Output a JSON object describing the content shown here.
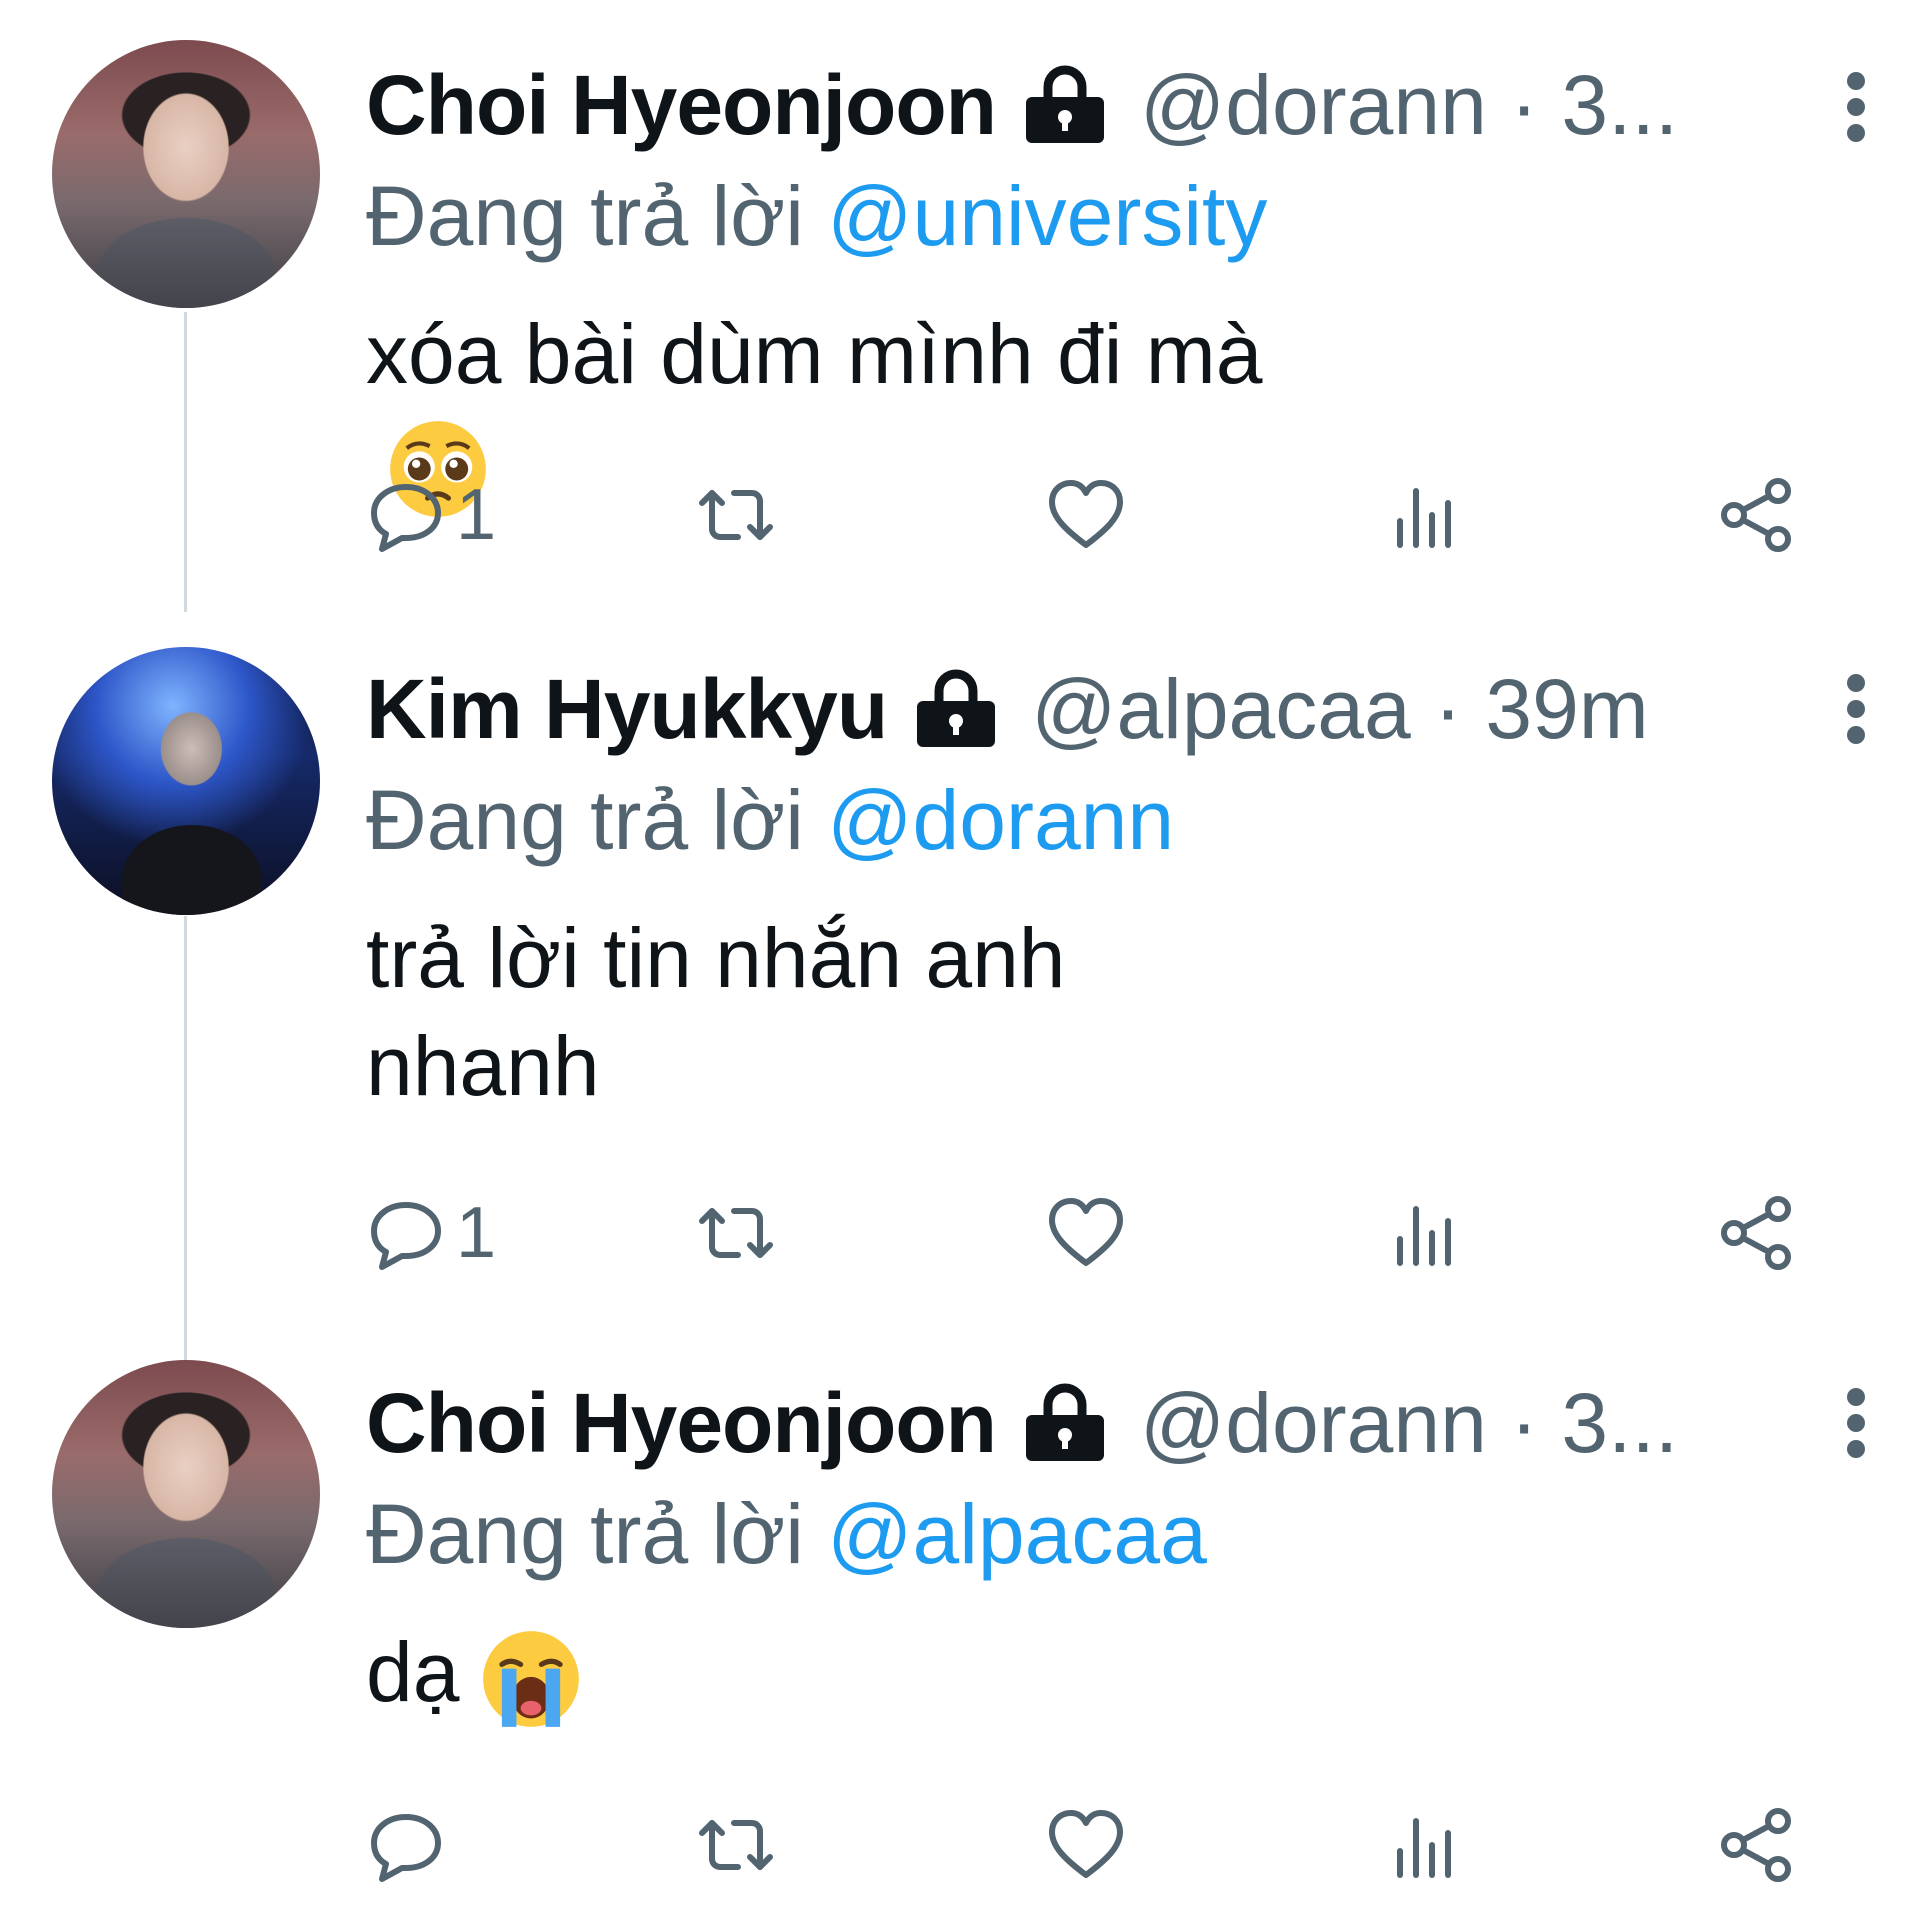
{
  "tweets": [
    {
      "name": "Choi Hyeonjoon",
      "handle": "@dorann · 3...",
      "reply_prefix": "Đang trả lời",
      "reply_to": "@university",
      "content_lines": [
        "xóa bài dùm mình đi mà"
      ],
      "emoji": "pleading-face-emoji",
      "reply_count": "1"
    },
    {
      "name": "Kim Hyukkyu",
      "handle": "@alpacaa · 39m",
      "reply_prefix": "Đang trả lời",
      "reply_to": "@dorann",
      "content_lines": [
        "trả lời tin nhắn anh",
        "nhanh"
      ],
      "reply_count": "1"
    },
    {
      "name": "Choi Hyeonjoon",
      "handle": "@dorann · 3...",
      "reply_prefix": "Đang trả lời",
      "reply_to": "@alpacaa",
      "content_lines": [
        "dạ"
      ],
      "emoji": "loudly-crying-face-emoji",
      "reply_count": ""
    }
  ],
  "colors": {
    "text": "#0f1419",
    "secondary": "#536471",
    "mention": "#1d9bf0",
    "thread_line": "#cfd9de"
  },
  "icons": [
    "lock-icon",
    "more-icon",
    "reply-icon",
    "retweet-icon",
    "like-icon",
    "views-icon",
    "share-icon"
  ]
}
